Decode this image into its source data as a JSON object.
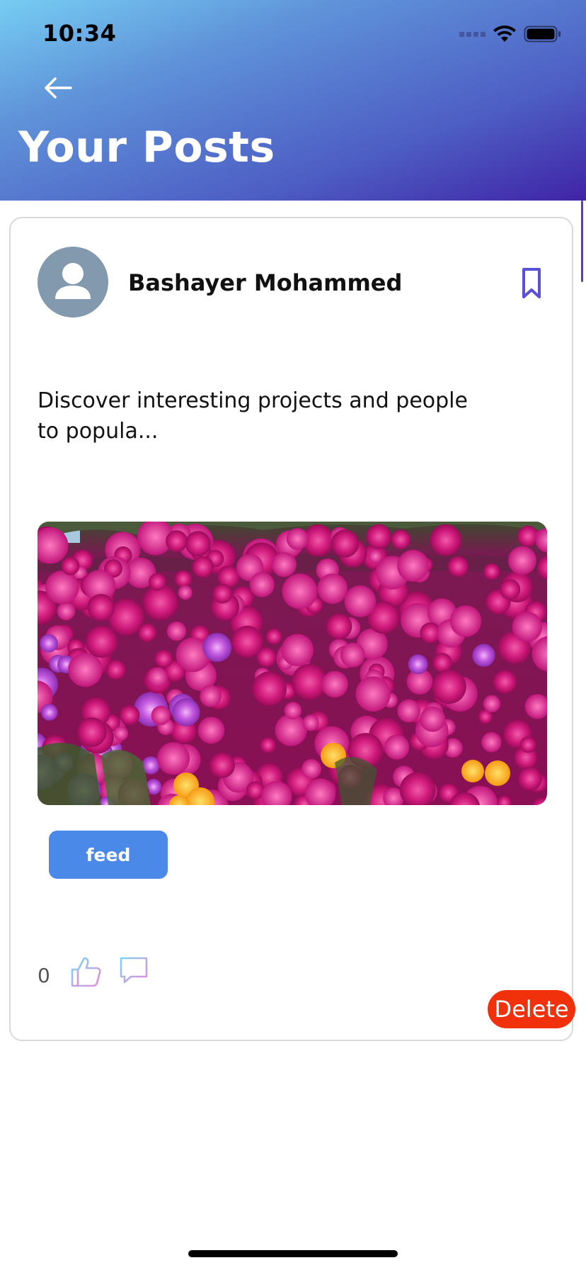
{
  "status_bar": {
    "time": "10:34",
    "icons": [
      "cellular-signal-icon",
      "wifi-icon",
      "battery-icon"
    ]
  },
  "header": {
    "title": "Your Posts",
    "back_icon": "arrow-left-icon",
    "gradient_colors": [
      "#76cdf3",
      "#5f93d9",
      "#4d5ec4",
      "#4024a6"
    ]
  },
  "post": {
    "author_name": "Bashayer Mohammed",
    "avatar_icon": "user-silhouette-icon",
    "bookmark_icon": "bookmark-icon",
    "text": "Discover interesting projects and people to popula...",
    "image_subject": "field of magenta, purple and orange flowers",
    "tag": "feed",
    "like_count": "0",
    "like_icon": "thumbs-up-icon",
    "comment_icon": "comment-icon",
    "delete_label": "Delete"
  },
  "colors": {
    "tag_background": "#4a89e8",
    "delete_background": "#f1300c",
    "bookmark": "#5a50d8",
    "avatar_background": "#8299ae"
  }
}
